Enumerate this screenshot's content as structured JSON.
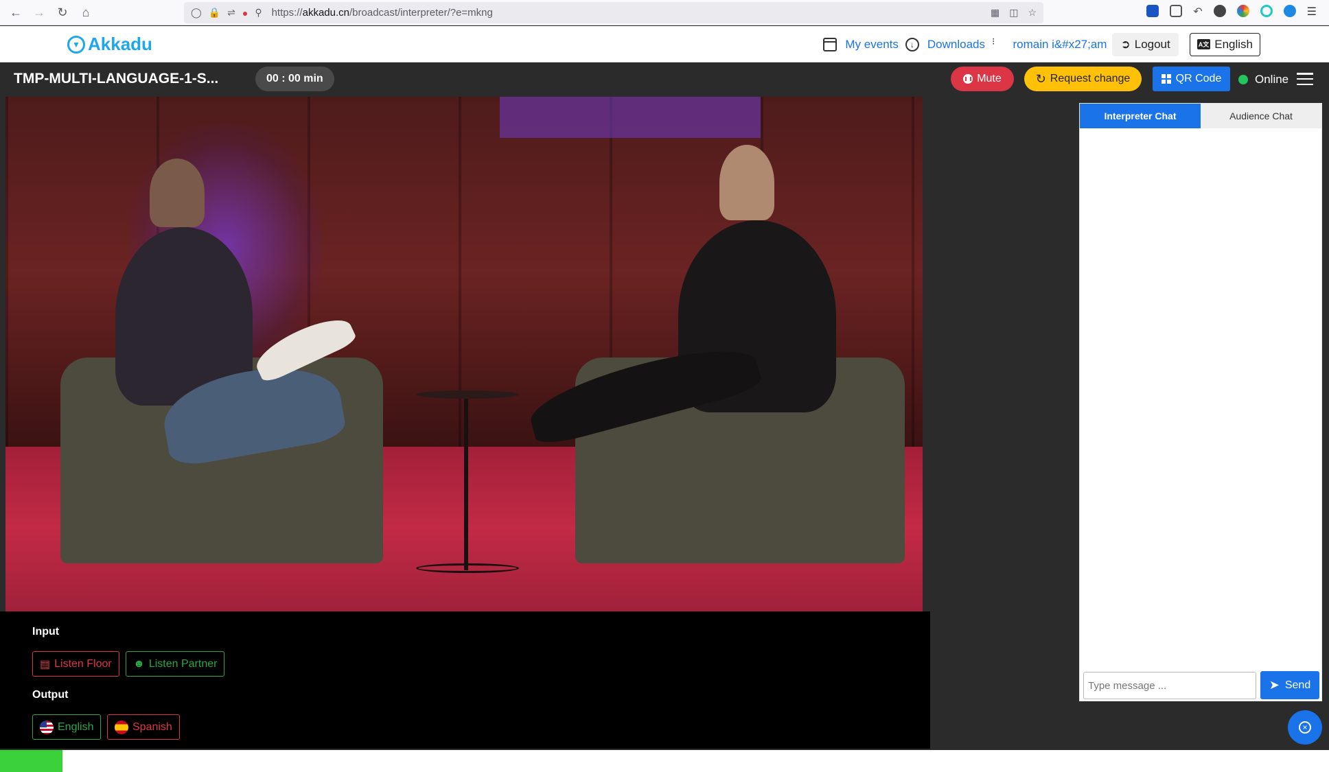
{
  "browser": {
    "url_prefix": "https://",
    "url_host": "akkadu.cn",
    "url_path": "/broadcast/interpreter/?e=mkng"
  },
  "header": {
    "logo_text": "Akkadu",
    "my_events_label": "My events",
    "downloads_label": "Downloads",
    "downloads_caret": "⁝",
    "user_label": "romain i&#x27;am",
    "logout_label": "Logout",
    "language_label": "English",
    "language_icon_text": "A文"
  },
  "toolbar": {
    "event_title": "TMP-MULTI-LANGUAGE-1-S...",
    "timer": "00 : 00 min",
    "mute_label": "Mute",
    "request_change_label": "Request change",
    "qr_code_label": "QR Code",
    "status_label": "Online"
  },
  "controls": {
    "input_heading": "Input",
    "listen_floor_label": "Listen Floor",
    "listen_partner_label": "Listen Partner",
    "output_heading": "Output",
    "output_english_label": "English",
    "output_spanish_label": "Spanish"
  },
  "chat": {
    "tabs": [
      {
        "label": "Interpreter Chat",
        "active": true
      },
      {
        "label": "Audience Chat",
        "active": false
      }
    ],
    "input_placeholder": "Type message ...",
    "send_label": "Send"
  },
  "audio_level_fraction": 0.047,
  "colors": {
    "brand": "#1ea7ef",
    "primary": "#1a73e8",
    "danger": "#dc3545",
    "warning": "#ffc107",
    "success": "#28a745",
    "online": "#22c55e"
  }
}
